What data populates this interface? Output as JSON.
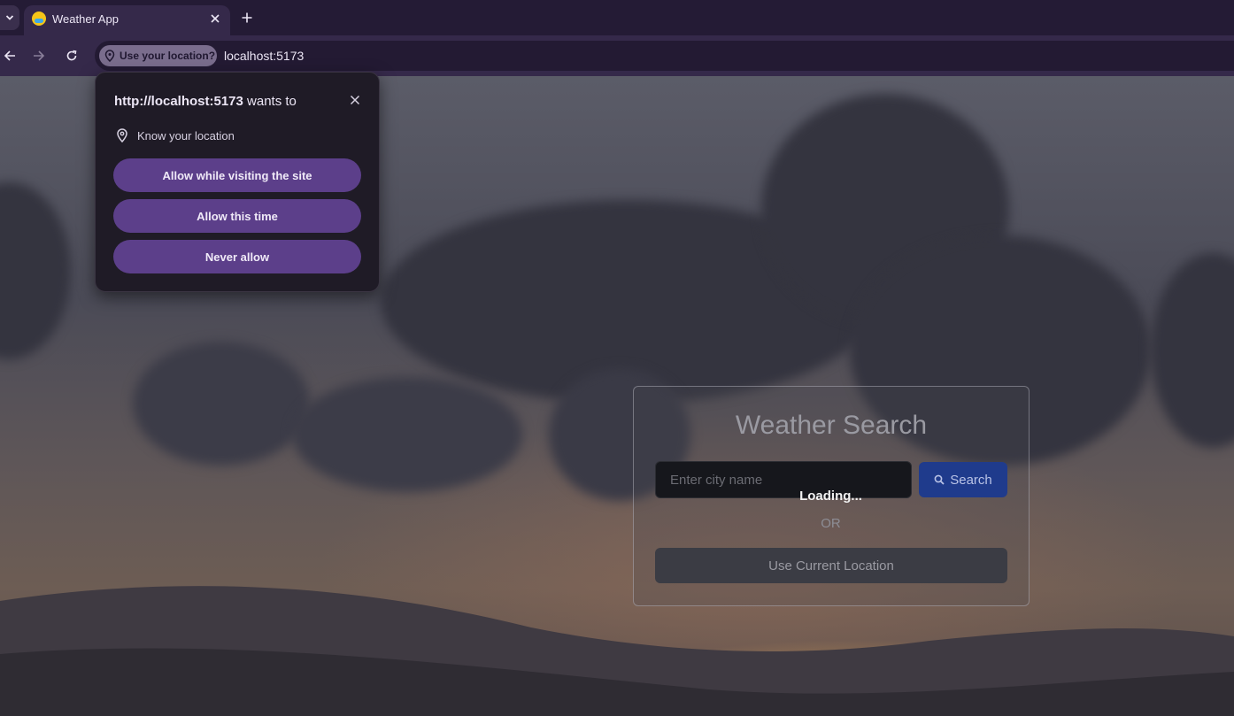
{
  "browser": {
    "tab": {
      "title": "Weather App"
    },
    "omnibox": {
      "chip_label": "Use your location?",
      "url": "localhost:5173"
    }
  },
  "permission_popup": {
    "origin": "http://localhost:5173",
    "title_suffix": " wants to",
    "permission": "Know your location",
    "buttons": {
      "allow_while_visiting": "Allow while visiting the site",
      "allow_this_time": "Allow this time",
      "never_allow": "Never allow"
    }
  },
  "weather_card": {
    "title": "Weather Search",
    "city_input": {
      "placeholder": "Enter city name",
      "value": ""
    },
    "search_label": "Search",
    "loading_text": "Loading...",
    "or_text": "OR",
    "current_location_label": "Use Current Location"
  },
  "colors": {
    "accent_purple": "#5c3f8a",
    "search_blue": "#1f3b8c",
    "chrome_bg": "#35294a"
  }
}
